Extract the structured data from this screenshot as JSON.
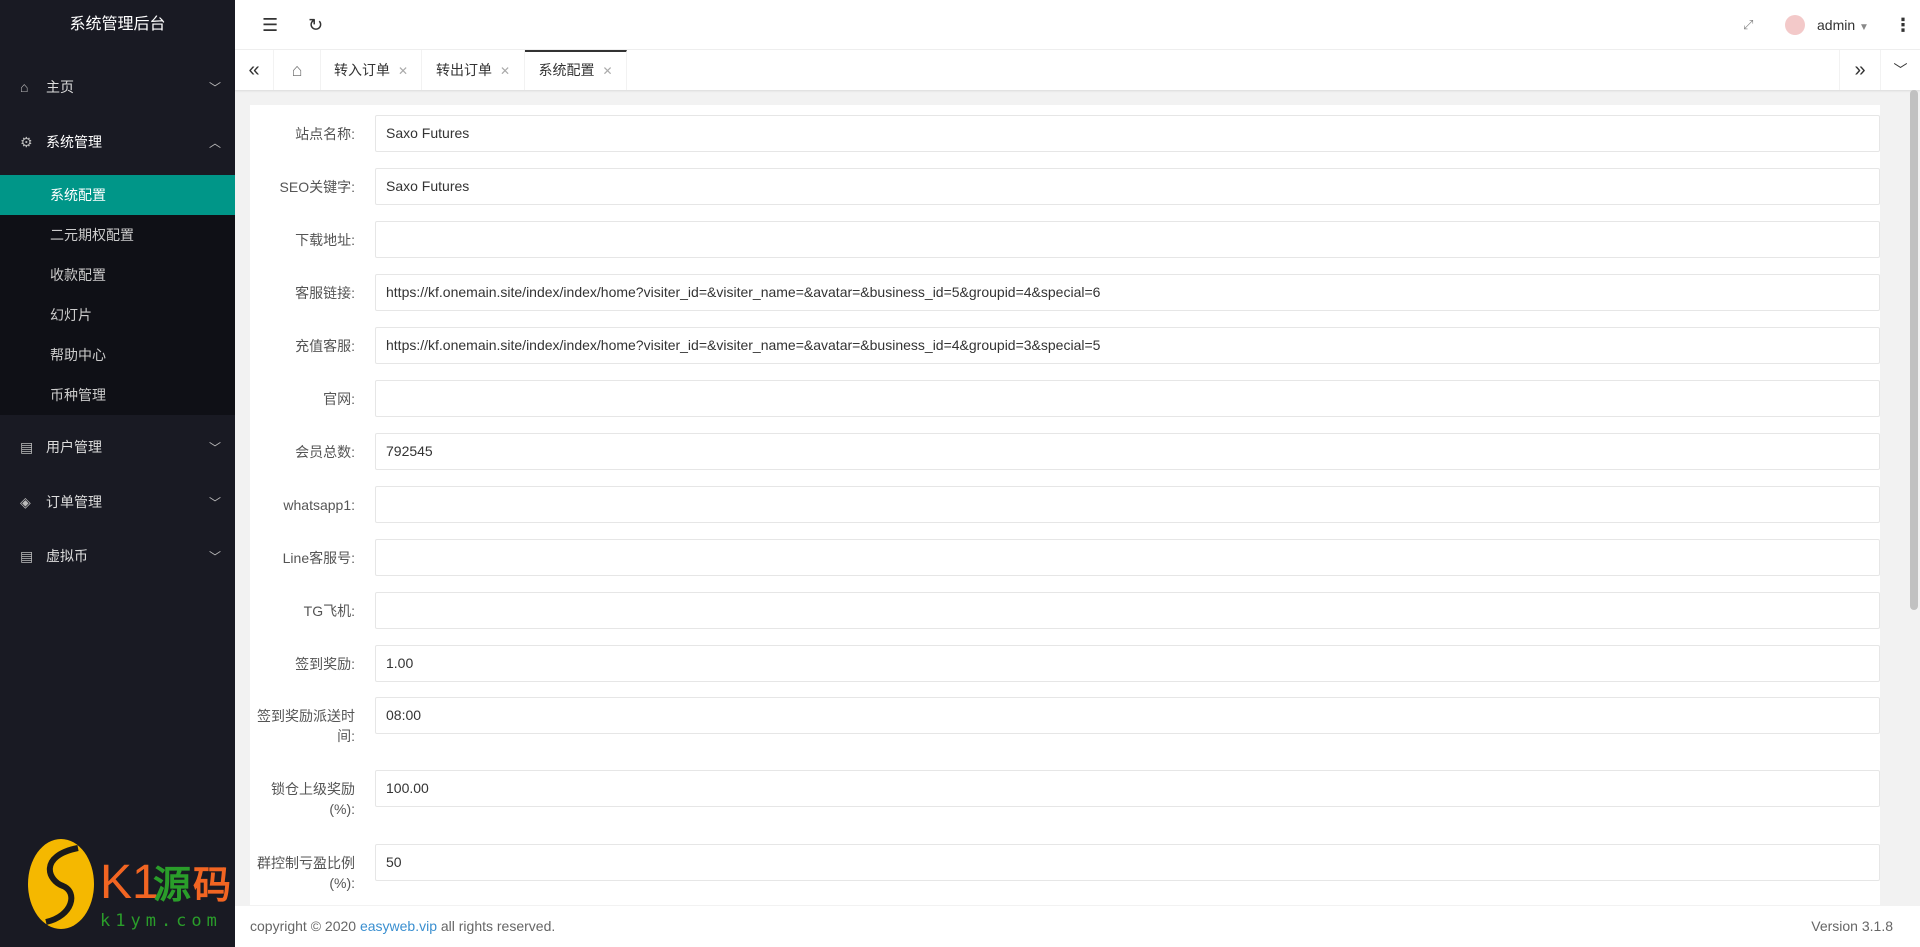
{
  "app_title": "系统管理后台",
  "sidebar": {
    "items": [
      {
        "label": "主页",
        "icon": "home-icon",
        "chev": "﹀"
      },
      {
        "label": "系统管理",
        "icon": "gear-icon",
        "chev": "︿"
      },
      {
        "label": "用户管理",
        "icon": "list-icon",
        "chev": "﹀"
      },
      {
        "label": "订单管理",
        "icon": "box-icon",
        "chev": "﹀"
      },
      {
        "label": "虚拟币",
        "icon": "list-icon",
        "chev": "﹀"
      }
    ],
    "sub_items": [
      "系统配置",
      "二元期权配置",
      "收款配置",
      "幻灯片",
      "帮助中心",
      "币种管理"
    ]
  },
  "header": {
    "user": "admin"
  },
  "tabs": [
    {
      "label": "转入订单"
    },
    {
      "label": "转出订单"
    },
    {
      "label": "系统配置"
    }
  ],
  "form": [
    {
      "label": "站点名称:",
      "value": "Saxo Futures"
    },
    {
      "label": "SEO关键字:",
      "value": "Saxo Futures"
    },
    {
      "label": "下载地址:",
      "value": ""
    },
    {
      "label": "客服链接:",
      "value": "https://kf.onemain.site/index/index/home?visiter_id=&visiter_name=&avatar=&business_id=5&groupid=4&special=6"
    },
    {
      "label": "充值客服:",
      "value": "https://kf.onemain.site/index/index/home?visiter_id=&visiter_name=&avatar=&business_id=4&groupid=3&special=5"
    },
    {
      "label": "官网:",
      "value": ""
    },
    {
      "label": "会员总数:",
      "value": "792545"
    },
    {
      "label": "whatsapp1:",
      "value": ""
    },
    {
      "label": "Line客服号:",
      "value": ""
    },
    {
      "label": "TG飞机:",
      "value": ""
    },
    {
      "label": "签到奖励:",
      "value": "1.00"
    },
    {
      "label": "签到奖励派送时间:",
      "value": "08:00"
    },
    {
      "label": "锁仓上级奖励(%):",
      "value": "100.00"
    },
    {
      "label": "群控制亏盈比例(%):",
      "value": "50"
    }
  ],
  "footer": {
    "prefix": "copyright © 2020 ",
    "link": "easyweb.vip",
    "suffix": " all rights reserved.",
    "version": "Version 3.1.8"
  },
  "watermark": {
    "brand": "K1源码",
    "domain": "k1ym.com"
  }
}
